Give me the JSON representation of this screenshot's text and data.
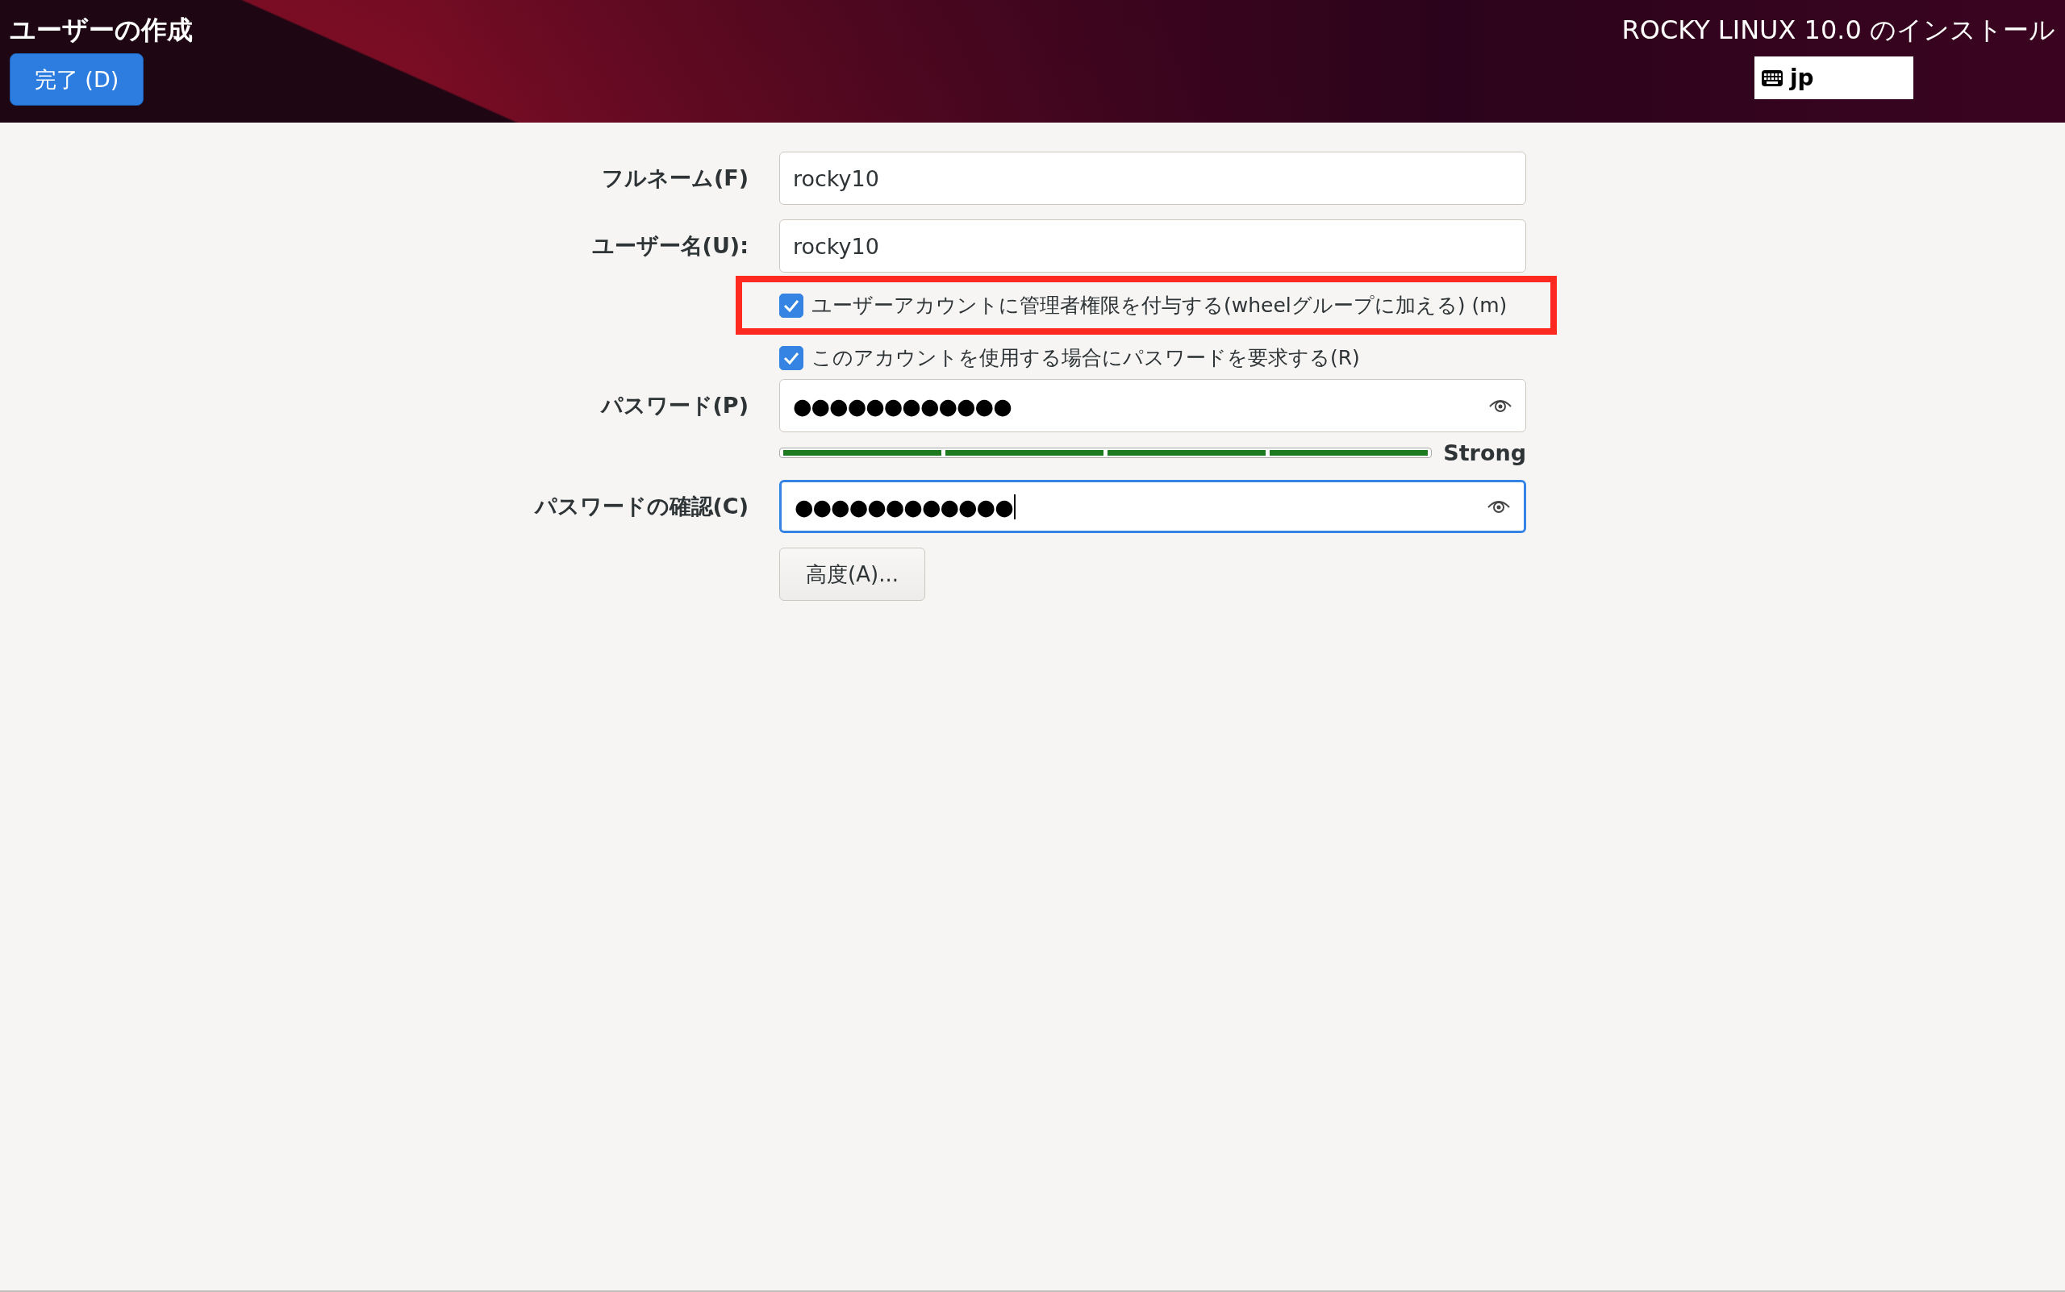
{
  "header": {
    "title": "ユーザーの作成",
    "done_button": "完了 (D)",
    "product_title": "ROCKY LINUX 10.0 のインストール",
    "keyboard_layout": "jp"
  },
  "fields": [
    {
      "label": "フルネーム(F)",
      "value": "rocky10",
      "focused": false
    },
    {
      "label": "ユーザー名(U):",
      "value": "rocky10",
      "focused": false
    }
  ],
  "checkboxes": [
    {
      "label": "ユーザーアカウントに管理者権限を付与する(wheelグループに加える) (m)",
      "checked": true,
      "highlighted": true
    },
    {
      "label": "このアカウントを使用する場合にパスワードを要求する(R)",
      "checked": true,
      "highlighted": false
    }
  ],
  "password": {
    "label": "パスワード(P)",
    "value": "●●●●●●●●●●●●",
    "focused": false
  },
  "strength": {
    "level": 1,
    "reading": "Strong"
  },
  "confirm": {
    "label": "パスワードの確認(C)",
    "value": "●●●●●●●●●●●●",
    "focused": true
  },
  "advanced_button": "高度(A)..."
}
